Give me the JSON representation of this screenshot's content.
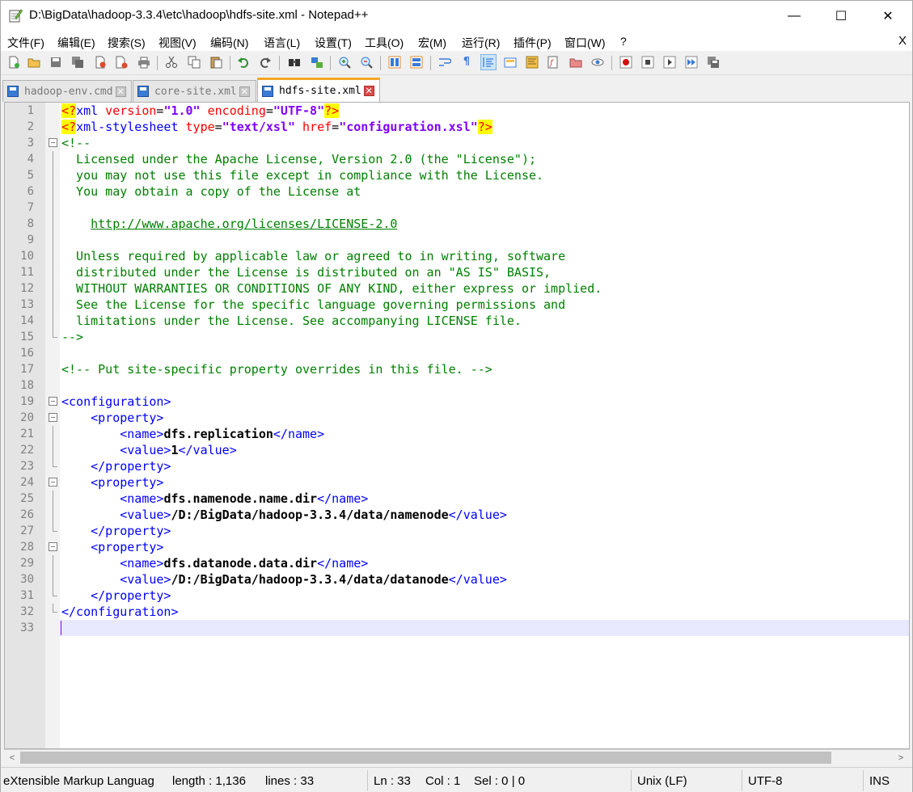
{
  "window": {
    "title": "D:\\BigData\\hadoop-3.3.4\\etc\\hadoop\\hdfs-site.xml - Notepad++",
    "minimize": "—",
    "maximize": "☐",
    "close": "✕"
  },
  "menu": {
    "items": [
      "文件(F)",
      "编辑(E)",
      "搜索(S)",
      "视图(V)",
      "编码(N)",
      "语言(L)",
      "设置(T)",
      "工具(O)",
      "宏(M)",
      "运行(R)",
      "插件(P)",
      "窗口(W)",
      "?"
    ],
    "close": "X"
  },
  "toolbar": {
    "icons": [
      "new-file-icon",
      "open-file-icon",
      "save-icon",
      "save-all-icon",
      "close-icon",
      "close-all-icon",
      "print-icon",
      "cut-icon",
      "copy-icon",
      "paste-icon",
      "undo-icon",
      "redo-icon",
      "find-icon",
      "replace-icon",
      "zoom-in-icon",
      "zoom-out-icon",
      "sync-vertical-icon",
      "sync-horizontal-icon",
      "word-wrap-icon",
      "show-all-chars-icon",
      "indent-guide-icon",
      "udl-icon",
      "doc-map-icon",
      "function-list-icon",
      "folder-workspace-icon",
      "monitoring-icon",
      "record-macro-icon",
      "stop-macro-icon",
      "play-macro-icon",
      "run-macro-multiple-icon",
      "save-macro-icon"
    ]
  },
  "tabs": [
    {
      "label": "hadoop-env.cmd",
      "active": false
    },
    {
      "label": "core-site.xml",
      "active": false
    },
    {
      "label": "hdfs-site.xml",
      "active": true
    }
  ],
  "editor": {
    "lines": [
      "1",
      "2",
      "3",
      "4",
      "5",
      "6",
      "7",
      "8",
      "9",
      "10",
      "11",
      "12",
      "13",
      "14",
      "15",
      "16",
      "17",
      "18",
      "19",
      "20",
      "21",
      "22",
      "23",
      "24",
      "25",
      "26",
      "27",
      "28",
      "29",
      "30",
      "31",
      "32",
      "33"
    ],
    "code": {
      "l1": {
        "pi_open": "<?",
        "tag": "xml",
        "a1": " version",
        "eq1": "=",
        "v1": "\"1.0\"",
        "a2": " encoding",
        "eq2": "=",
        "v2": "\"UTF-8\"",
        "pi_close": "?>"
      },
      "l2": {
        "pi_open": "<?",
        "tag": "xml-stylesheet",
        "a1": " type",
        "eq1": "=",
        "v1": "\"text/xsl\"",
        "a2": " href",
        "eq2": "=",
        "v2": "\"configuration.xsl\"",
        "pi_close": "?>"
      },
      "l3": "<!--",
      "l4": "  Licensed under the Apache License, Version 2.0 (the \"License\");",
      "l5": "  you may not use this file except in compliance with the License.",
      "l6": "  You may obtain a copy of the License at",
      "l8_indent": "    ",
      "l8_url": "http://www.apache.org/licenses/LICENSE-2.0",
      "l10": "  Unless required by applicable law or agreed to in writing, software",
      "l11": "  distributed under the License is distributed on an \"AS IS\" BASIS,",
      "l12": "  WITHOUT WARRANTIES OR CONDITIONS OF ANY KIND, either express or implied.",
      "l13": "  See the License for the specific language governing permissions and",
      "l14": "  limitations under the License. See accompanying LICENSE file.",
      "l15": "-->",
      "l17": "<!-- Put site-specific property overrides in this file. -->",
      "l19": "<configuration>",
      "l20": "    <property>",
      "l21_o": "        <name>",
      "l21_t": "dfs.replication",
      "l21_c": "</name>",
      "l22_o": "        <value>",
      "l22_t": "1",
      "l22_c": "</value>",
      "l23": "    </property>",
      "l24": "    <property>",
      "l25_o": "        <name>",
      "l25_t": "dfs.namenode.name.dir",
      "l25_c": "</name>",
      "l26_o": "        <value>",
      "l26_t": "/D:/BigData/hadoop-3.3.4/data/namenode",
      "l26_c": "</value>",
      "l27": "    </property>",
      "l28": "    <property>",
      "l29_o": "        <name>",
      "l29_t": "dfs.datanode.data.dir",
      "l29_c": "</name>",
      "l30_o": "        <value>",
      "l30_t": "/D:/BigData/hadoop-3.3.4/data/datanode",
      "l30_c": "</value>",
      "l31": "    </property>",
      "l32": "</configuration>"
    }
  },
  "scrollbar": {
    "left": "<",
    "right": ">"
  },
  "status": {
    "language": "eXtensible Markup Languag",
    "length": "length : 1,136",
    "lines": "lines : 33",
    "ln": "Ln : 33",
    "col": "Col : 1",
    "sel": "Sel : 0 | 0",
    "eol": "Unix (LF)",
    "encoding": "UTF-8",
    "mode": "INS"
  }
}
